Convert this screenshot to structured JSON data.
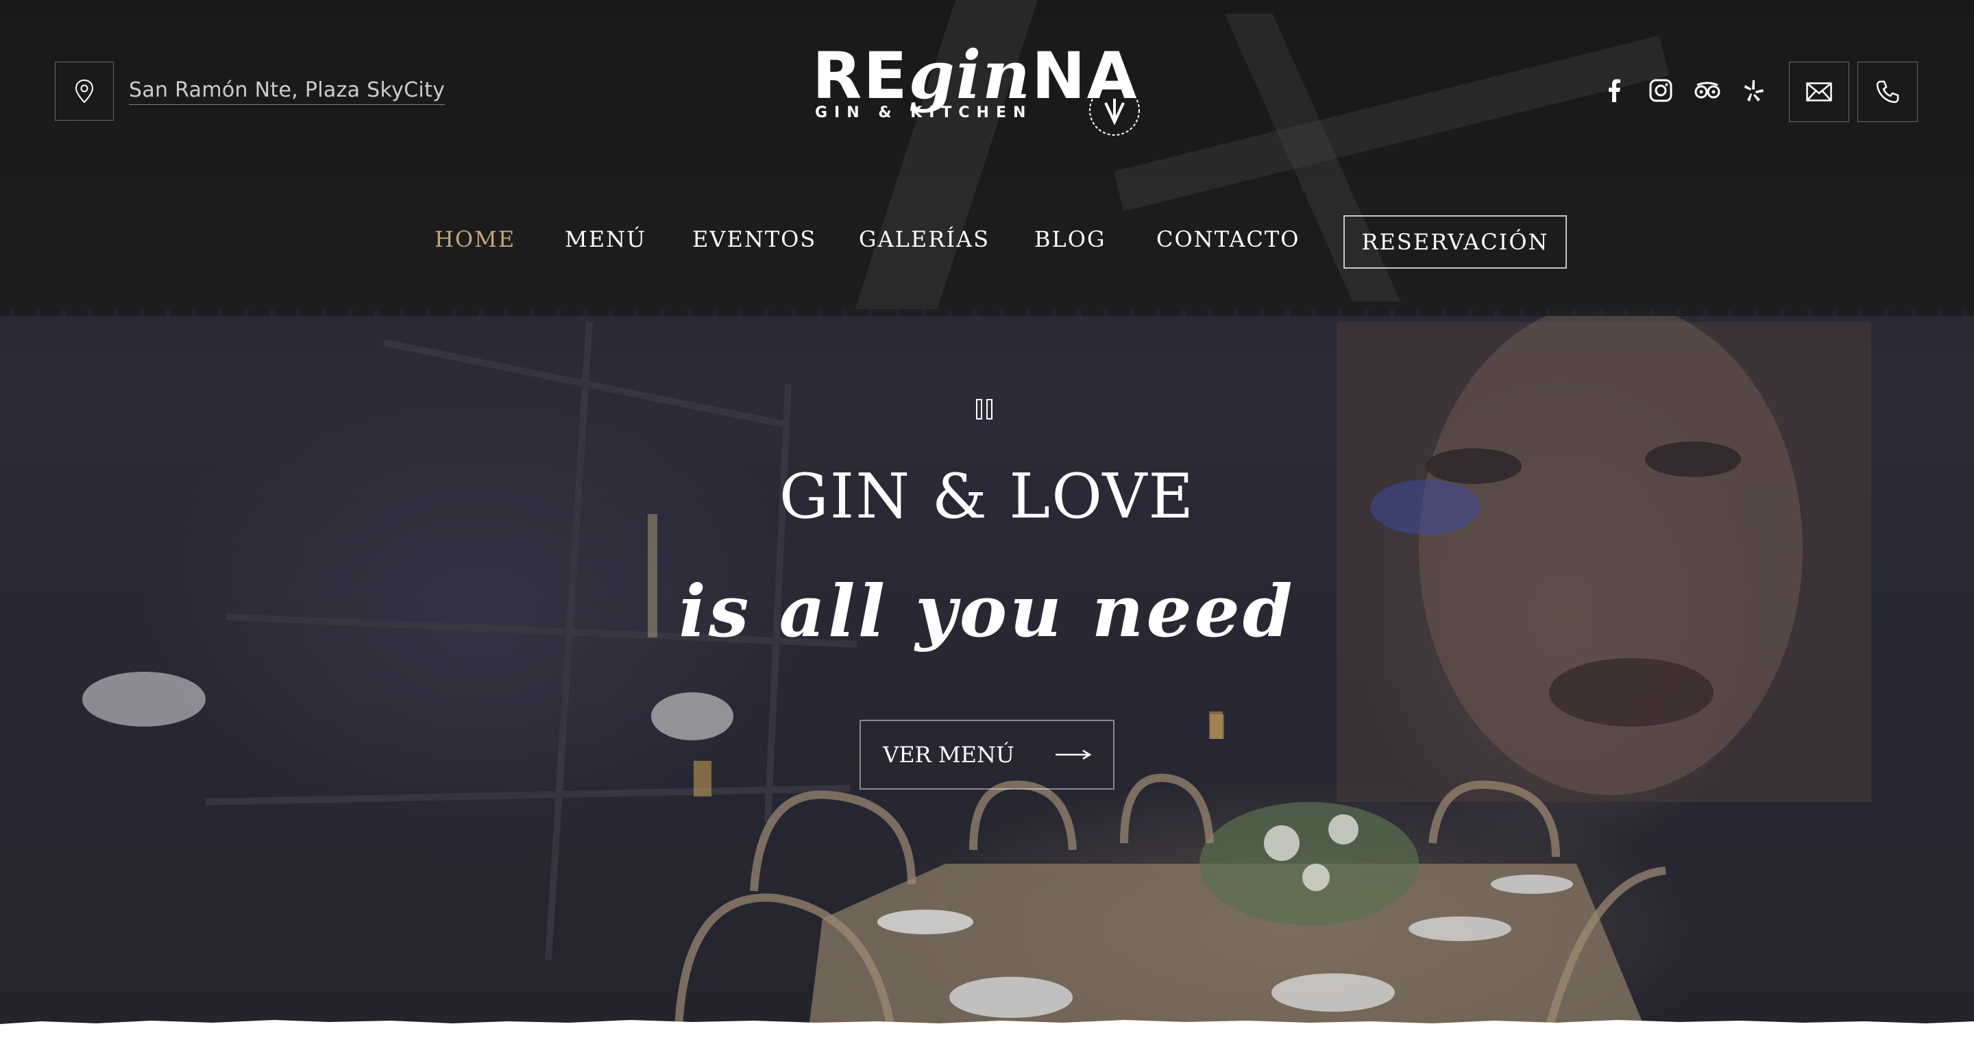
{
  "header": {
    "location": "San Ramón Nte, Plaza SkyCity",
    "logo": {
      "main_prefix": "RE",
      "main_script": "gin",
      "main_suffix": "NA",
      "tagline": "GIN & KITCHEN"
    },
    "social_icons": [
      "facebook-icon",
      "instagram-icon",
      "tripadvisor-icon",
      "yelp-icon"
    ],
    "contact_icons": [
      "mail-icon",
      "phone-icon"
    ]
  },
  "nav": {
    "items": [
      "HOME",
      "MENÚ",
      "EVENTOS",
      "GALERÍAS",
      "BLOG",
      "CONTACTO"
    ],
    "active": "HOME",
    "reserve_label": "RESERVACIÓN"
  },
  "hero": {
    "title": "GIN & LOVE",
    "script": "is all you need",
    "cta_label": "VER MENÚ",
    "video_state": "pause-icon"
  },
  "colors": {
    "accent": "#c4a777",
    "header_bg": "#1b1b1d",
    "hero_overlay": "#272733"
  }
}
